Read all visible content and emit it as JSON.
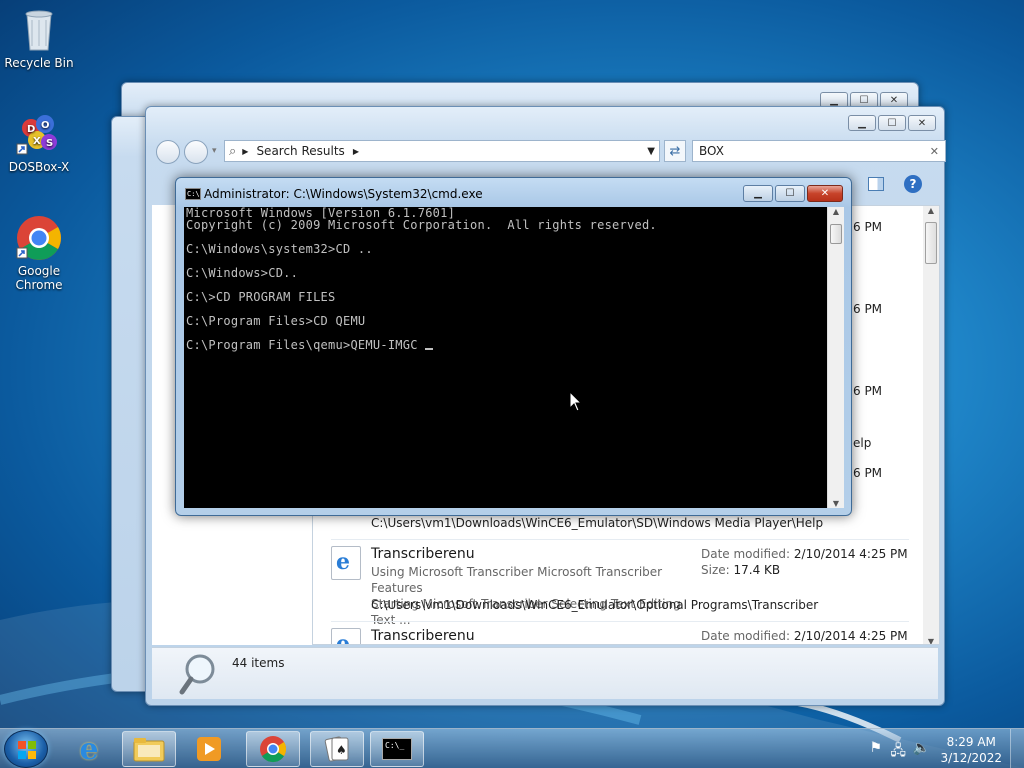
{
  "desktop": {
    "icons": [
      {
        "label": "Recycle Bin",
        "icon": "recycle-bin-icon"
      },
      {
        "label": "DOSBox-X",
        "icon": "dosbox-icon"
      },
      {
        "label": "Google Chrome",
        "icon": "chrome-icon"
      }
    ]
  },
  "explorer": {
    "address": "Search Results",
    "search_value": "BOX",
    "status_count": "44 items",
    "partial_times": [
      "6 PM",
      "6 PM",
      "6 PM",
      "6 PM"
    ],
    "partial_help": "elp",
    "results": [
      {
        "path": "C:\\Users\\vm1\\Downloads\\WinCE6_Emulator\\SD\\Windows Media Player\\Help"
      },
      {
        "name": "Transcriberenu",
        "desc1": "Using Microsoft Transcriber Microsoft Transcriber Features",
        "desc2": "Starting Microsoft Transcriber Selecting Text Editing Text ...",
        "date_label": "Date modified:",
        "date": "2/10/2014 4:25 PM",
        "size_label": "Size:",
        "size": "17.4 KB",
        "path": "C:\\Users\\vm1\\Downloads\\WinCE6_Emulator\\Optional Programs\\Transcriber"
      },
      {
        "name": "Transcriberenu",
        "date_label": "Date modified:",
        "date": "2/10/2014 4:25 PM"
      }
    ]
  },
  "cmd": {
    "title": "Administrator: C:\\Windows\\System32\\cmd.exe",
    "icon_text": "C:\\",
    "lines": [
      "Microsoft Windows [Version 6.1.7601]",
      "Copyright (c) 2009 Microsoft Corporation.  All rights reserved.",
      "",
      "C:\\Windows\\system32>CD ..",
      "",
      "C:\\Windows>CD..",
      "",
      "C:\\>CD PROGRAM FILES",
      "",
      "C:\\Program Files>CD QEMU",
      "",
      "C:\\Program Files\\qemu>QEMU-IMGC "
    ]
  },
  "taskbar": {
    "time": "8:29 AM",
    "date": "3/12/2022",
    "cmd_label": "C:\\_"
  }
}
